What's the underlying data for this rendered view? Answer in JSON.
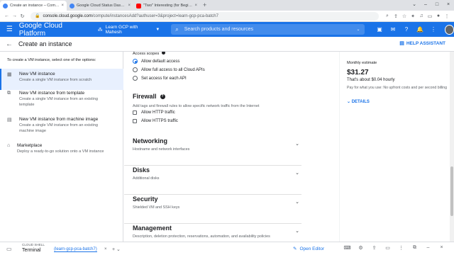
{
  "browser": {
    "tabs": [
      {
        "title": "Create an instance – Compute E",
        "fav_color": "#4285f4",
        "active": true
      },
      {
        "title": "Google Cloud Status Dashboard",
        "fav_color": "#4285f4",
        "active": false
      },
      {
        "title": "\"Two\" Interesting (for Beginners",
        "fav_color": "#ff0000",
        "active": false
      }
    ],
    "url_host": "console.cloud.google.com",
    "url_path": "/compute/instancesAdd?authuser=3&project=learn-gcp-pca-batch7"
  },
  "header": {
    "brand": "Google Cloud Platform",
    "project": "Learn GCP with Mahesh",
    "search_placeholder": "Search products and resources"
  },
  "page": {
    "title": "Create an instance",
    "help_label": "HELP ASSISTANT"
  },
  "left": {
    "intro": "To create a VM instance, select one of the options:",
    "options": [
      {
        "title": "New VM instance",
        "desc": "Create a single VM instance from scratch",
        "icon": "vm-icon"
      },
      {
        "title": "New VM instance from template",
        "desc": "Create a single VM instance from an existing template",
        "icon": "template-icon"
      },
      {
        "title": "New VM instance from machine image",
        "desc": "Create a single VM instance from an existing machine image",
        "icon": "machine-image-icon"
      },
      {
        "title": "Marketplace",
        "desc": "Deploy a ready-to-go solution onto a VM instance",
        "icon": "marketplace-icon"
      }
    ]
  },
  "form": {
    "access_scopes_label": "Access scopes",
    "scopes": [
      {
        "label": "Allow default access",
        "selected": true
      },
      {
        "label": "Allow full access to all Cloud APIs",
        "selected": false
      },
      {
        "label": "Set access for each API",
        "selected": false
      }
    ],
    "firewall": {
      "title": "Firewall",
      "desc": "Add tags and firewall rules to allow specific network traffic from the Internet",
      "http": "Allow HTTP traffic",
      "https": "Allow HTTPS traffic"
    },
    "sections": [
      {
        "title": "Networking",
        "desc": "Hostname and network interfaces"
      },
      {
        "title": "Disks",
        "desc": "Additional disks"
      },
      {
        "title": "Security",
        "desc": "Shielded VM and SSH keys"
      },
      {
        "title": "Management",
        "desc": "Description, deletion protection, reservations, automation, and availability policies"
      }
    ]
  },
  "estimate": {
    "heading": "Monthly estimate",
    "price": "$31.27",
    "hourly": "That's about $0.04 hourly",
    "note": "Pay for what you use: No upfront costs and per second billing",
    "details": "DETAILS"
  },
  "shell": {
    "label": "CLOUD SHELL",
    "terminal": "Terminal",
    "tab": "(learn-gcp-pca-batch7)",
    "editor": "Open Editor"
  },
  "colors": {
    "accent": "#1a73e8",
    "selected_bg": "#e8f0fe"
  }
}
